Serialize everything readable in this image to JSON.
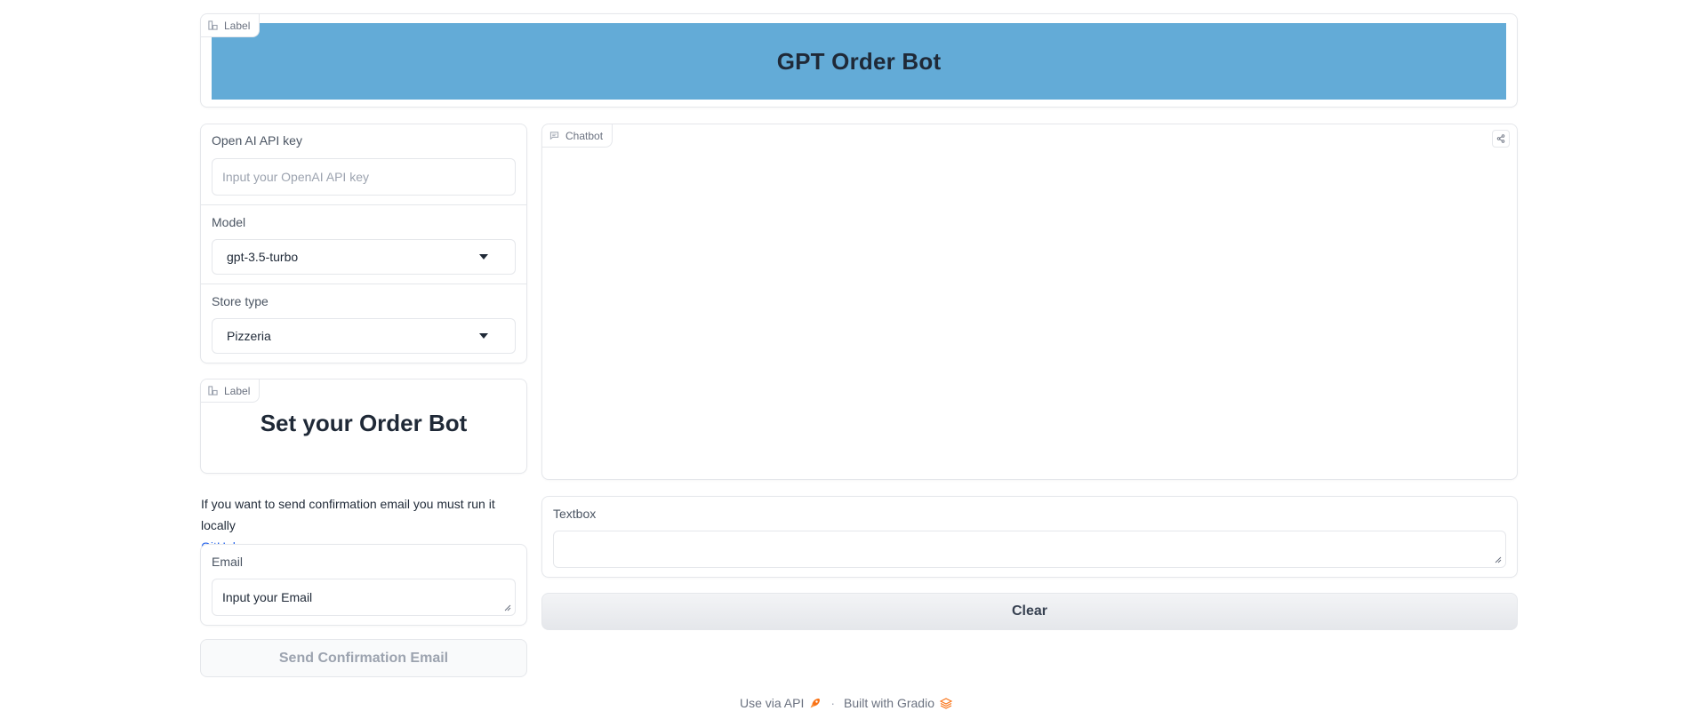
{
  "header": {
    "tag_label": "Label",
    "title": "GPT Order Bot",
    "banner_color": "#63abd7"
  },
  "settings": {
    "api_key": {
      "label": "Open AI API key",
      "placeholder": "Input your OpenAI API key",
      "value": ""
    },
    "model": {
      "label": "Model",
      "selected": "gpt-3.5-turbo"
    },
    "store_type": {
      "label": "Store type",
      "selected": "Pizzeria"
    }
  },
  "order_label": {
    "tag_label": "Label",
    "title": "Set your Order Bot"
  },
  "note": {
    "text": "If you want to send confirmation email you must run it locally",
    "link_text": "GitHub repo"
  },
  "email": {
    "label": "Email",
    "value": "Input your Email"
  },
  "send_button": {
    "label": "Send Confirmation Email"
  },
  "chatbot": {
    "tag_label": "Chatbot"
  },
  "textbox": {
    "label": "Textbox",
    "value": ""
  },
  "clear_button": {
    "label": "Clear"
  },
  "footer": {
    "api_text": "Use via API",
    "separator": "·",
    "built_text": "Built with Gradio"
  },
  "icons": {
    "label_tag": "label-icon",
    "chat_tag": "chat-icon",
    "share": "share-icon",
    "rocket": "rocket-icon",
    "gradio": "gradio-logo-icon"
  }
}
